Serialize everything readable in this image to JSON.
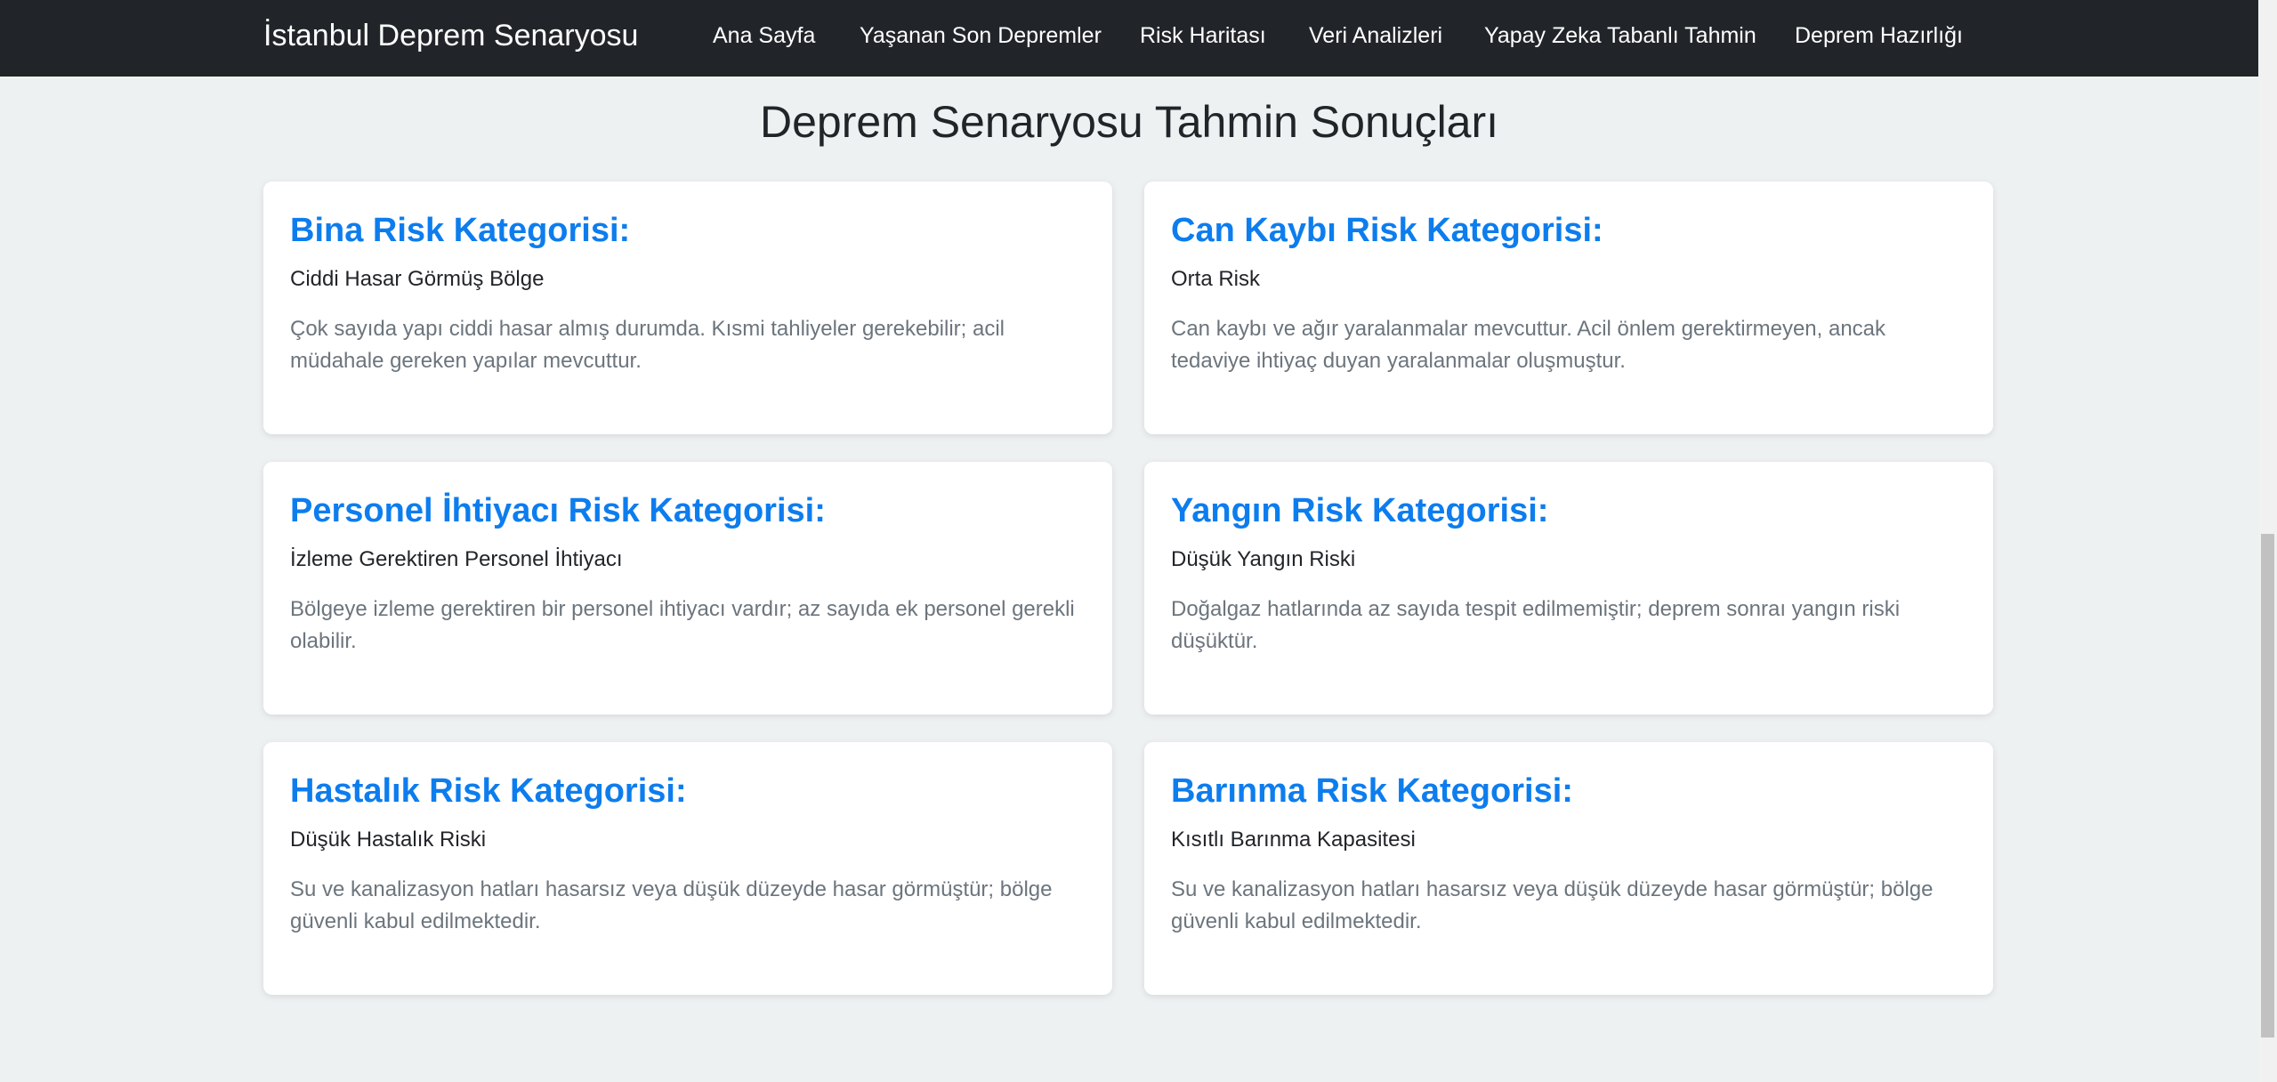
{
  "navbar": {
    "brand": "İstanbul Deprem Senaryosu",
    "links": [
      {
        "label": "Ana Sayfa"
      },
      {
        "label": "Yaşanan Son Depremler"
      },
      {
        "label": "Risk Haritası"
      },
      {
        "label": "Veri Analizleri"
      },
      {
        "label": "Yapay Zeka Tabanlı Tahmin"
      },
      {
        "label": "Deprem Hazırlığı"
      }
    ]
  },
  "main": {
    "title": "Deprem Senaryosu Tahmin Sonuçları",
    "cards": [
      {
        "title": "Bina Risk Kategorisi:",
        "category": "Ciddi Hasar Görmüş Bölge",
        "description": "Çok sayıda yapı ciddi hasar almış durumda. Kısmi tahliyeler gerekebilir; acil müdahale gereken yapılar mevcuttur."
      },
      {
        "title": "Can Kaybı Risk Kategorisi:",
        "category": "Orta Risk",
        "description": "Can kaybı ve ağır yaralanmalar mevcuttur. Acil önlem gerektirmeyen, ancak tedaviye ihtiyaç duyan yaralanmalar oluşmuştur."
      },
      {
        "title": "Personel İhtiyacı Risk Kategorisi:",
        "category": "İzleme Gerektiren Personel İhtiyacı",
        "description": "Bölgeye izleme gerektiren bir personel ihtiyacı vardır; az sayıda ek personel gerekli olabilir."
      },
      {
        "title": "Yangın Risk Kategorisi:",
        "category": "Düşük Yangın Riski",
        "description": "Doğalgaz hatlarında az sayıda tespit edilmemiştir; deprem sonraı yangın riski düşüktür."
      },
      {
        "title": "Hastalık Risk Kategorisi:",
        "category": "Düşük Hastalık Riski",
        "description": "Su ve kanalizasyon hatları hasarsız veya düşük düzeyde hasar görmüştür; bölge güvenli kabul edilmektedir."
      },
      {
        "title": "Barınma Risk Kategorisi:",
        "category": "Kısıtlı Barınma Kapasitesi",
        "description": "Su ve kanalizasyon hatları hasarsız veya düşük düzeyde hasar görmüştür; bölge güvenli kabul edilmektedir."
      }
    ]
  },
  "colors": {
    "navbar_bg": "#212529",
    "page_bg": "#eef1f2",
    "card_title": "#0d7dee",
    "muted_text": "#6c757d"
  }
}
